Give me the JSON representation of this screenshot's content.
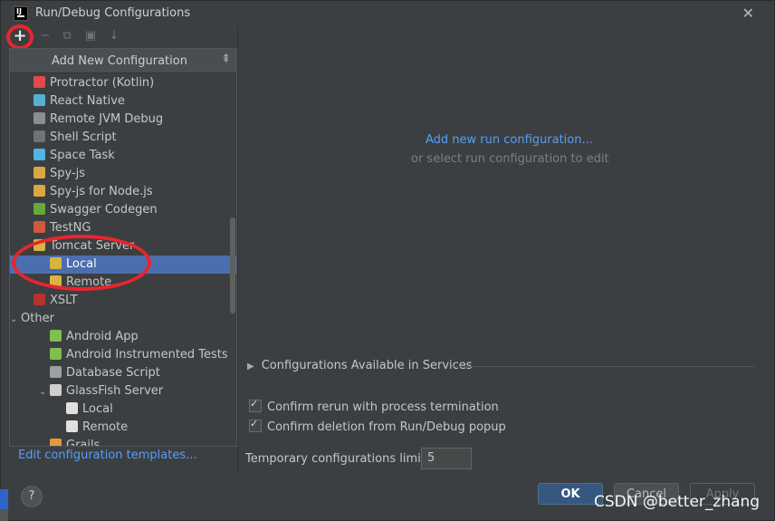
{
  "window": {
    "title": "Run/Debug Configurations"
  },
  "toolbar": {
    "add": "+",
    "remove": "−",
    "copy": "⧉",
    "folder": "▣",
    "sort": "↓"
  },
  "popup": {
    "title": "Add New Configuration",
    "collapse_icon": "collapse-icon"
  },
  "tree": [
    {
      "label": "Protractor (Kotlin)",
      "icon": "protractor-icon",
      "color": "#e04a4a",
      "indent": 1
    },
    {
      "label": "React Native",
      "icon": "react-icon",
      "color": "#55b0d6",
      "indent": 1
    },
    {
      "label": "Remote JVM Debug",
      "icon": "remote-debug-icon",
      "color": "#8b8e91",
      "indent": 1
    },
    {
      "label": "Shell Script",
      "icon": "shell-icon",
      "color": "#6e7375",
      "indent": 1
    },
    {
      "label": "Space Task",
      "icon": "space-icon",
      "color": "#4fb5e3",
      "indent": 1
    },
    {
      "label": "Spy-js",
      "icon": "spyjs-icon",
      "color": "#d9a743",
      "indent": 1
    },
    {
      "label": "Spy-js for Node.js",
      "icon": "spyjs-node-icon",
      "color": "#d9a743",
      "indent": 1
    },
    {
      "label": "Swagger Codegen",
      "icon": "swagger-icon",
      "color": "#69a83a",
      "indent": 1
    },
    {
      "label": "TestNG",
      "icon": "testng-icon",
      "color": "#d05a3a",
      "indent": 1
    },
    {
      "label": "Tomcat Server",
      "icon": "tomcat-icon",
      "color": "#d8b343",
      "indent": 1,
      "expanded": true
    },
    {
      "label": "Local",
      "icon": "tomcat-local-icon",
      "color": "#d8b343",
      "indent": 2,
      "selected": true
    },
    {
      "label": "Remote",
      "icon": "tomcat-remote-icon",
      "color": "#d8b343",
      "indent": 2
    },
    {
      "label": "XSLT",
      "icon": "xslt-icon",
      "color": "#b3342b",
      "indent": 1
    },
    {
      "label": "Other",
      "icon": "",
      "color": "",
      "indent": 0,
      "expanded": true
    },
    {
      "label": "Android App",
      "icon": "android-icon",
      "color": "#7fbf4d",
      "indent": 2
    },
    {
      "label": "Android Instrumented Tests",
      "icon": "android-test-icon",
      "color": "#7fbf4d",
      "indent": 2
    },
    {
      "label": "Database Script",
      "icon": "database-icon",
      "color": "#9aa0a4",
      "indent": 2
    },
    {
      "label": "GlassFish Server",
      "icon": "glassfish-icon",
      "color": "#cfcfcf",
      "indent": 2,
      "expanded": true
    },
    {
      "label": "Local",
      "icon": "glassfish-local-icon",
      "color": "#e0e0e0",
      "indent": 3
    },
    {
      "label": "Remote",
      "icon": "glassfish-remote-icon",
      "color": "#e0e0e0",
      "indent": 3
    },
    {
      "label": "Grails",
      "icon": "grails-icon",
      "color": "#e09a3a",
      "indent": 2
    }
  ],
  "left_footer": {
    "link": "Edit configuration templates..."
  },
  "right": {
    "add_link": "Add new run configuration...",
    "hint": "or select run configuration to edit",
    "services_label": "Configurations Available in Services",
    "confirm_rerun": "Confirm rerun with process termination",
    "confirm_deletion": "Confirm deletion from Run/Debug popup",
    "limit_label": "Temporary configurations limit:",
    "limit_value": "5"
  },
  "buttons": {
    "ok": "OK",
    "cancel": "Cancel",
    "apply": "Apply",
    "help": "?"
  },
  "watermark": "CSDN @better_zhang",
  "colors": {
    "accent": "#4b6eaf",
    "link": "#589df6",
    "annotation": "#e8252f"
  }
}
